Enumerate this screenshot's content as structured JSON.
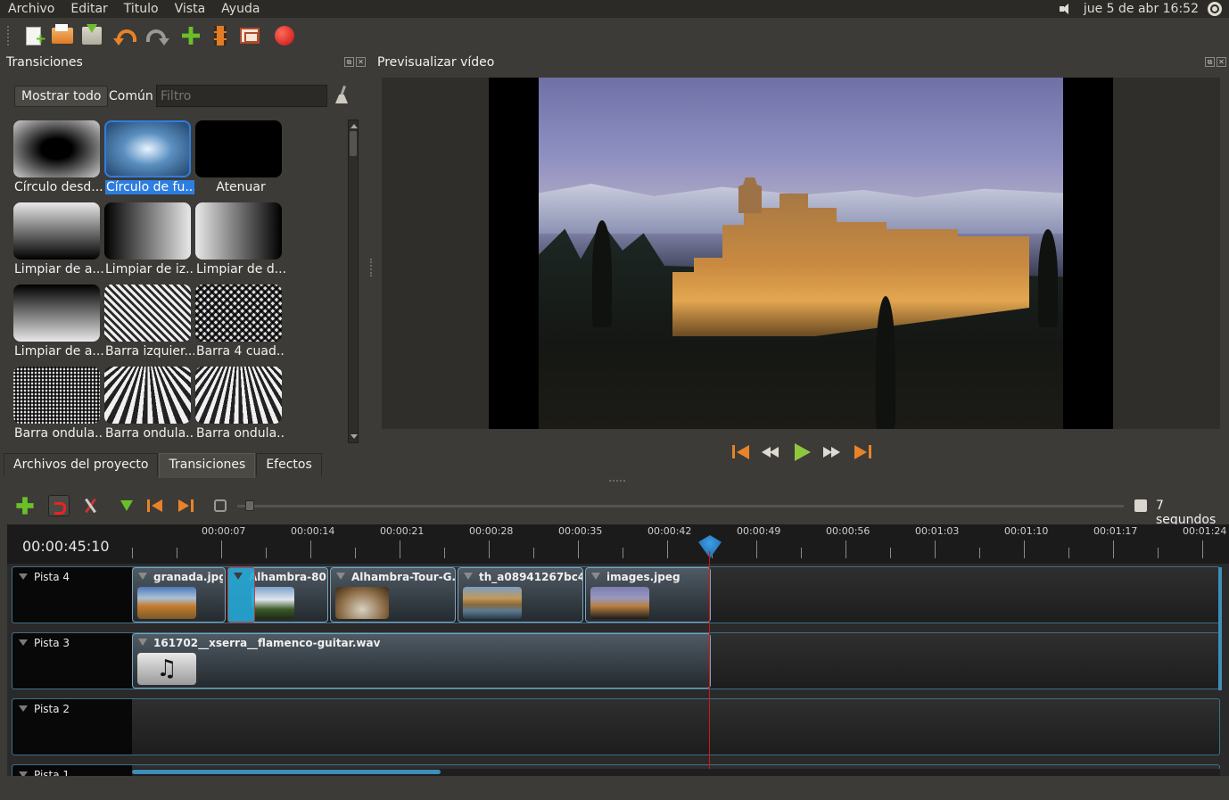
{
  "menubar": {
    "items": [
      "Archivo",
      "Editar",
      "Titulo",
      "Vista",
      "Ayuda"
    ],
    "clock": "jue  5 de abr 16:52"
  },
  "toolbar": {
    "icons": [
      "new-project-icon",
      "open-project-icon",
      "save-project-icon",
      "undo-icon",
      "redo-icon",
      "import-files-icon",
      "profile-icon",
      "fullscreen-icon",
      "export-video-icon"
    ]
  },
  "transitions_panel": {
    "title": "Transiciones",
    "show_all": "Mostrar todo",
    "common": "Común",
    "filter_placeholder": "Filtro",
    "items": [
      {
        "label": "Círculo desd..."
      },
      {
        "label": "Círculo de fu..."
      },
      {
        "label": "Atenuar"
      },
      {
        "label": "Limpiar de a..."
      },
      {
        "label": "Limpiar de iz..."
      },
      {
        "label": "Limpiar de d..."
      },
      {
        "label": "Limpiar de a..."
      },
      {
        "label": "Barra izquier..."
      },
      {
        "label": "Barra 4 cuad..."
      },
      {
        "label": "Barra ondula..."
      },
      {
        "label": "Barra ondula..."
      },
      {
        "label": "Barra ondula..."
      }
    ],
    "selected_index": 1
  },
  "tabs": [
    "Archivos del proyecto",
    "Transiciones",
    "Efectos"
  ],
  "active_tab": "Transiciones",
  "preview": {
    "title": "Previsualizar vídeo"
  },
  "timeline": {
    "zoom_label": "7 segundos",
    "timecode": "00:00:45:10",
    "ticks": [
      "00:00:07",
      "00:00:14",
      "00:00:21",
      "00:00:28",
      "00:00:35",
      "00:00:42",
      "00:00:49",
      "00:00:56",
      "00:01:03",
      "00:01:10",
      "00:01:17",
      "00:01:24"
    ],
    "tracks": [
      {
        "name": "Pista 4",
        "clips": [
          "granada.jpg",
          "Alhambra-80...",
          "Alhambra-Tour-G...",
          "th_a08941267bc4...",
          "images.jpeg"
        ]
      },
      {
        "name": "Pista 3",
        "clips": [
          "161702__xserra__flamenco-guitar.wav"
        ]
      },
      {
        "name": "Pista 2",
        "clips": []
      },
      {
        "name": "Pista 1",
        "clips": []
      }
    ]
  },
  "colors": {
    "accent_orange": "#e8832a",
    "add_green": "#6bbf2a",
    "selection_blue": "#2e7de0",
    "playhead_red": "#d01818"
  }
}
